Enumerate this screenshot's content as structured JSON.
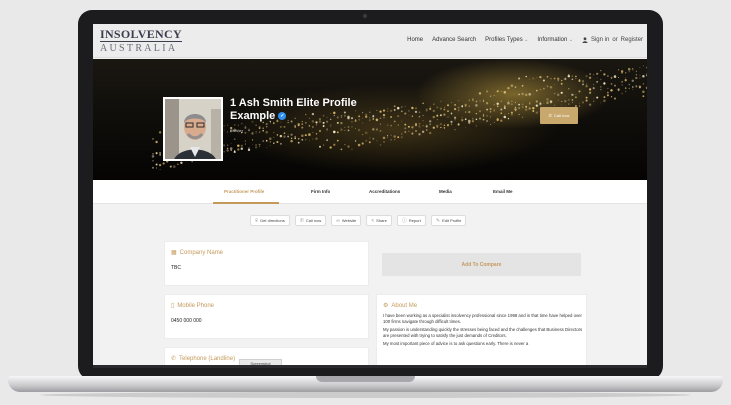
{
  "header": {
    "logo_line1": "INSOLVENCY",
    "logo_line2": "AUSTRALIA",
    "nav": [
      {
        "label": "Home",
        "dropdown": false
      },
      {
        "label": "Advance Search",
        "dropdown": false
      },
      {
        "label": "Profiles Types",
        "dropdown": true
      },
      {
        "label": "Information",
        "dropdown": true
      }
    ],
    "signin": "Sign in",
    "or": "or",
    "register": "Register"
  },
  "profile": {
    "name": "1 Ash Smith Elite Profile Example",
    "role": "Partner",
    "call_button": "Call now",
    "verified_icon": "verified-check-icon"
  },
  "tabs": [
    "Practitioner Profile",
    "Firm Info",
    "Accreditations",
    "Media",
    "Email Me"
  ],
  "actions": [
    {
      "label": "Get directions",
      "icon": "location-icon"
    },
    {
      "label": "Call now",
      "icon": "phone-icon"
    },
    {
      "label": "Website",
      "icon": "link-icon"
    },
    {
      "label": "Share",
      "icon": "share-icon"
    },
    {
      "label": "Report",
      "icon": "report-icon"
    },
    {
      "label": "Edit Profile",
      "icon": "edit-profile-icon"
    }
  ],
  "company": {
    "title": "Company Name",
    "value": "TBC"
  },
  "mobile": {
    "title": "Mobile Phone",
    "value": "0450 000 000"
  },
  "landline": {
    "title": "Telephone (Landline)"
  },
  "compare_button": "Add To Compare",
  "about": {
    "title": "About Me",
    "paragraphs": [
      "I have been working as a specialist insolvency professional since 1998 and in that time have helped over 100 firms navigate through difficult times.",
      "My passion is understanding quickly the stresses being faced and the challenges that Business Directors are presented with trying to satisfy the just demands of Creditors.",
      "My most important piece of advice is to ask questions early. There is never a"
    ]
  },
  "tooltip": "Screenshot",
  "colors": {
    "accent": "#c49a5c",
    "hero_dark": "#050403",
    "verified": "#2d8ff0"
  }
}
